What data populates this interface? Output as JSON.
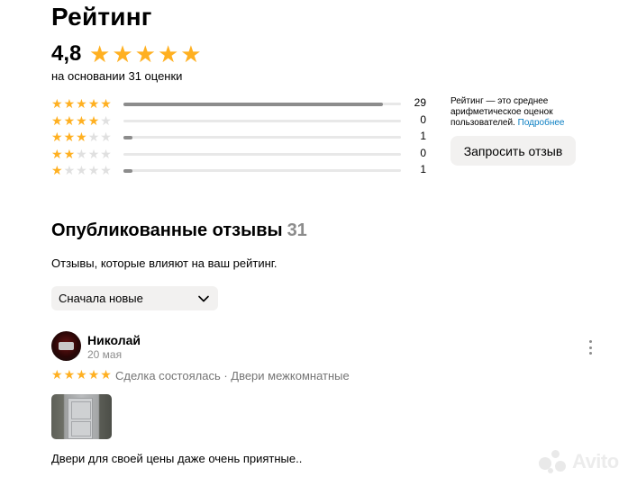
{
  "page": {
    "title": "Рейтинг"
  },
  "summary": {
    "rating": "4,8",
    "stars": 5,
    "based_on": "на основании 31 оценки"
  },
  "distribution": [
    {
      "stars": 5,
      "count": "29",
      "fraction": 0.935
    },
    {
      "stars": 4,
      "count": "0",
      "fraction": 0
    },
    {
      "stars": 3,
      "count": "1",
      "fraction": 0.032
    },
    {
      "stars": 2,
      "count": "0",
      "fraction": 0
    },
    {
      "stars": 1,
      "count": "1",
      "fraction": 0.032
    }
  ],
  "info": {
    "text": "Рейтинг — это среднее арифметическое оценок пользователей.",
    "more_link": "Подробнее"
  },
  "request_button": "Запросить отзыв",
  "published": {
    "title": "Опубликованные отзывы",
    "count": "31",
    "description": "Отзывы, которые влияют на ваш рейтинг.",
    "sort_selected": "Сначала новые"
  },
  "review": {
    "author": "Николай",
    "date": "20 мая",
    "stars": 5,
    "meta": "Сделка состоялась · Двери межкомнатные",
    "text": "Двери для своей цены даже очень приятные.."
  },
  "watermark": "Avito",
  "colors": {
    "star": "#ffb021",
    "star_off": "#e0e0e0",
    "bar_fill": "#8c8c8c",
    "link": "#0a7ec2",
    "button_bg": "#f2f1f0",
    "muted": "#8c8c8c"
  }
}
